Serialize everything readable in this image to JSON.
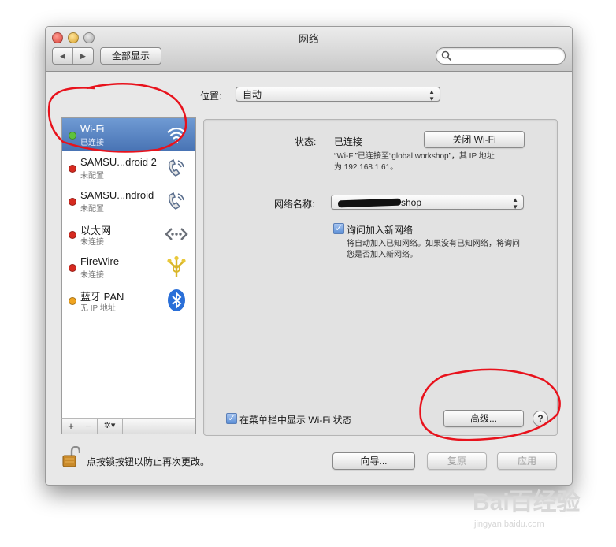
{
  "window": {
    "title": "网络",
    "show_all": "全部显示",
    "search": {
      "placeholder": "",
      "value": ""
    }
  },
  "location": {
    "label": "位置:",
    "value": "自动"
  },
  "services": [
    {
      "name": "Wi-Fi",
      "status": "已连接",
      "dot_color": "#5ec23b",
      "icon": "wifi-icon"
    },
    {
      "name": "SAMSU...droid 2",
      "status": "未配置",
      "dot_color": "#d62a20",
      "icon": "phone-icon"
    },
    {
      "name": "SAMSU...ndroid",
      "status": "未配置",
      "dot_color": "#d62a20",
      "icon": "phone-icon"
    },
    {
      "name": "以太网",
      "status": "未连接",
      "dot_color": "#d62a20",
      "icon": "ethernet-icon"
    },
    {
      "name": "FireWire",
      "status": "未连接",
      "dot_color": "#d62a20",
      "icon": "firewire-icon"
    },
    {
      "name": "蓝牙 PAN",
      "status": "无 IP 地址",
      "dot_color": "#f0a420",
      "icon": "bluetooth-icon"
    }
  ],
  "sidebar_tools": {
    "add": "+",
    "remove": "−",
    "gear": "✲▾"
  },
  "detail": {
    "status_label": "状态:",
    "status_value": "已连接",
    "turn_off_button": "关闭 Wi-Fi",
    "status_desc_1": "“Wi-Fi”已连接至“global workshop”，其 IP 地址",
    "status_desc_2": "为 192.168.1.61。",
    "network_name_label": "网络名称:",
    "network_name_value": "shop",
    "ask_join_label": "询问加入新网络",
    "ask_join_desc_1": "将自动加入已知网络。如果没有已知网络，将询问",
    "ask_join_desc_2": "您是否加入新网络。",
    "menubar_label": "在菜单栏中显示 Wi-Fi 状态",
    "advanced_button": "高级...",
    "help": "?"
  },
  "footer": {
    "lock_text": "点按锁按钮以防止再次更改。",
    "assist_button": "向导...",
    "revert_button": "复原",
    "apply_button": "应用"
  },
  "watermark": {
    "logo": "Bai百经验",
    "sub": "jingyan.baidu.com"
  },
  "colors": {
    "selection": "#4f7cbf",
    "annotation": "#e8121c"
  }
}
